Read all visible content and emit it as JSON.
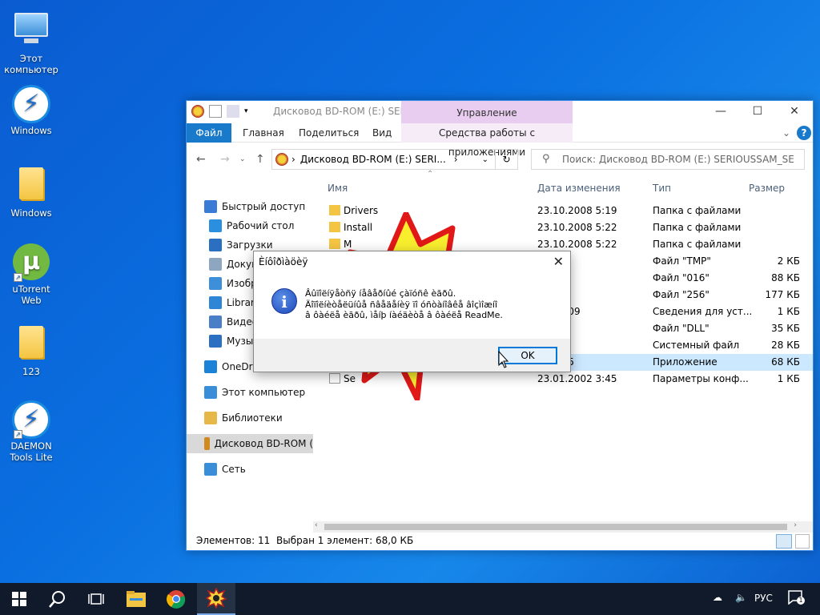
{
  "desktop": {
    "icons": [
      {
        "label": "Этот\nкомпьютер",
        "icon": "computer-icon"
      },
      {
        "label": "Windows",
        "icon": "daemon-tools-icon"
      },
      {
        "label": "Windows",
        "icon": "folder-icon"
      },
      {
        "label": "uTorrent Web",
        "icon": "utorrent-icon"
      },
      {
        "label": "123",
        "icon": "folder-icon"
      },
      {
        "label": "DAEMON\nTools Lite",
        "icon": "daemon-tools-icon"
      }
    ]
  },
  "explorer": {
    "title": "Дисковод BD-ROM (E:) SERI...",
    "manage_tab": "Управление",
    "tabs": {
      "file": "Файл",
      "home": "Главная",
      "share": "Поделиться",
      "view": "Вид",
      "app_tools": "Средства работы с приложениями"
    },
    "address": "Дисковод BD-ROM (E:) SERI...",
    "search_placeholder": "Поиск: Дисковод BD-ROM (E:) SERIOUSSAM_SE",
    "nav": [
      {
        "label": "Быстрый доступ",
        "icon": "star-icon",
        "color": "#3a7bd5"
      },
      {
        "label": "Рабочий стол",
        "icon": "desktop-icon",
        "color": "#2b8fe0"
      },
      {
        "label": "Загрузки",
        "icon": "download-icon",
        "color": "#2b6fc0"
      },
      {
        "label": "Документы",
        "icon": "documents-icon",
        "color": "#8fa6c0"
      },
      {
        "label": "Изображения",
        "icon": "pictures-icon",
        "color": "#3c8fd8"
      },
      {
        "label": "Libraries",
        "icon": "libraries-icon",
        "color": "#2f85d6"
      },
      {
        "label": "Видео",
        "icon": "video-icon",
        "color": "#4a7fc8"
      },
      {
        "label": "Музыка",
        "icon": "music-icon",
        "color": "#2d6fc0"
      },
      {
        "label": "OneDrive",
        "icon": "onedrive-icon",
        "color": "#1b82d8"
      },
      {
        "label": "Этот компьютер",
        "icon": "computer-icon",
        "color": "#3a8ed8"
      },
      {
        "label": "Библиотеки",
        "icon": "libraries-icon",
        "color": "#e6b84a"
      },
      {
        "label": "Дисковод BD-ROM (",
        "icon": "serious-sam-icon",
        "color": "#d08a20"
      },
      {
        "label": "Сеть",
        "icon": "network-icon",
        "color": "#3a8ed8"
      }
    ],
    "columns": {
      "name": "Имя",
      "date": "Дата изменения",
      "type": "Тип",
      "size": "Размер"
    },
    "files": [
      {
        "name": "Drivers",
        "date": "23.10.2008 5:19",
        "type": "Папка с файлами",
        "size": ""
      },
      {
        "name": "Install",
        "date": "23.10.2008 5:22",
        "type": "Папка с файлами",
        "size": ""
      },
      {
        "name": "M",
        "date": "23.10.2008 5:22",
        "type": "Папка с файлами",
        "size": ""
      },
      {
        "name": "",
        "date": "2 7:34",
        "type": "Файл \"TMP\"",
        "size": "2 КБ"
      },
      {
        "name": "",
        "date": "2 7:34",
        "type": "Файл \"016\"",
        "size": "88 КБ"
      },
      {
        "name": "",
        "date": "2 7:34",
        "type": "Файл \"256\"",
        "size": "177 КБ"
      },
      {
        "name": "",
        "date": "01 10:09",
        "type": "Сведения для уст...",
        "size": "1 КБ"
      },
      {
        "name": "",
        "date": "2 7:34",
        "type": "Файл \"DLL\"",
        "size": "35 КБ"
      },
      {
        "name": "",
        "date": "2 7:34",
        "type": "Системный файл",
        "size": "28 КБ"
      },
      {
        "name": "",
        "date": "01 2:35",
        "type": "Приложение",
        "size": "68 КБ"
      },
      {
        "name": "Se",
        "date": "23.01.2002 3:45",
        "type": "Параметры конф...",
        "size": "1 КБ"
      }
    ],
    "status": {
      "count": "Элементов: 11",
      "selected": "Выбран 1 элемент: 68,0 КБ"
    }
  },
  "dialog": {
    "title": "Èíôîðìàöèÿ",
    "line1": "Âûïîëíÿåòñÿ íåâåðíûé çàïóñê èãðû.",
    "line2": "Äîïîëíèòåëüíûå ñâåäåíèÿ ïî óñòàíîâêå âîçìîæíî",
    "line3": "â ôàéëå èãðû, ìåíþ íàéäèòå â ôàéëå ReadMe.",
    "ok": "OK"
  },
  "taskbar": {
    "lang": "РУС",
    "notif_count": "1"
  }
}
